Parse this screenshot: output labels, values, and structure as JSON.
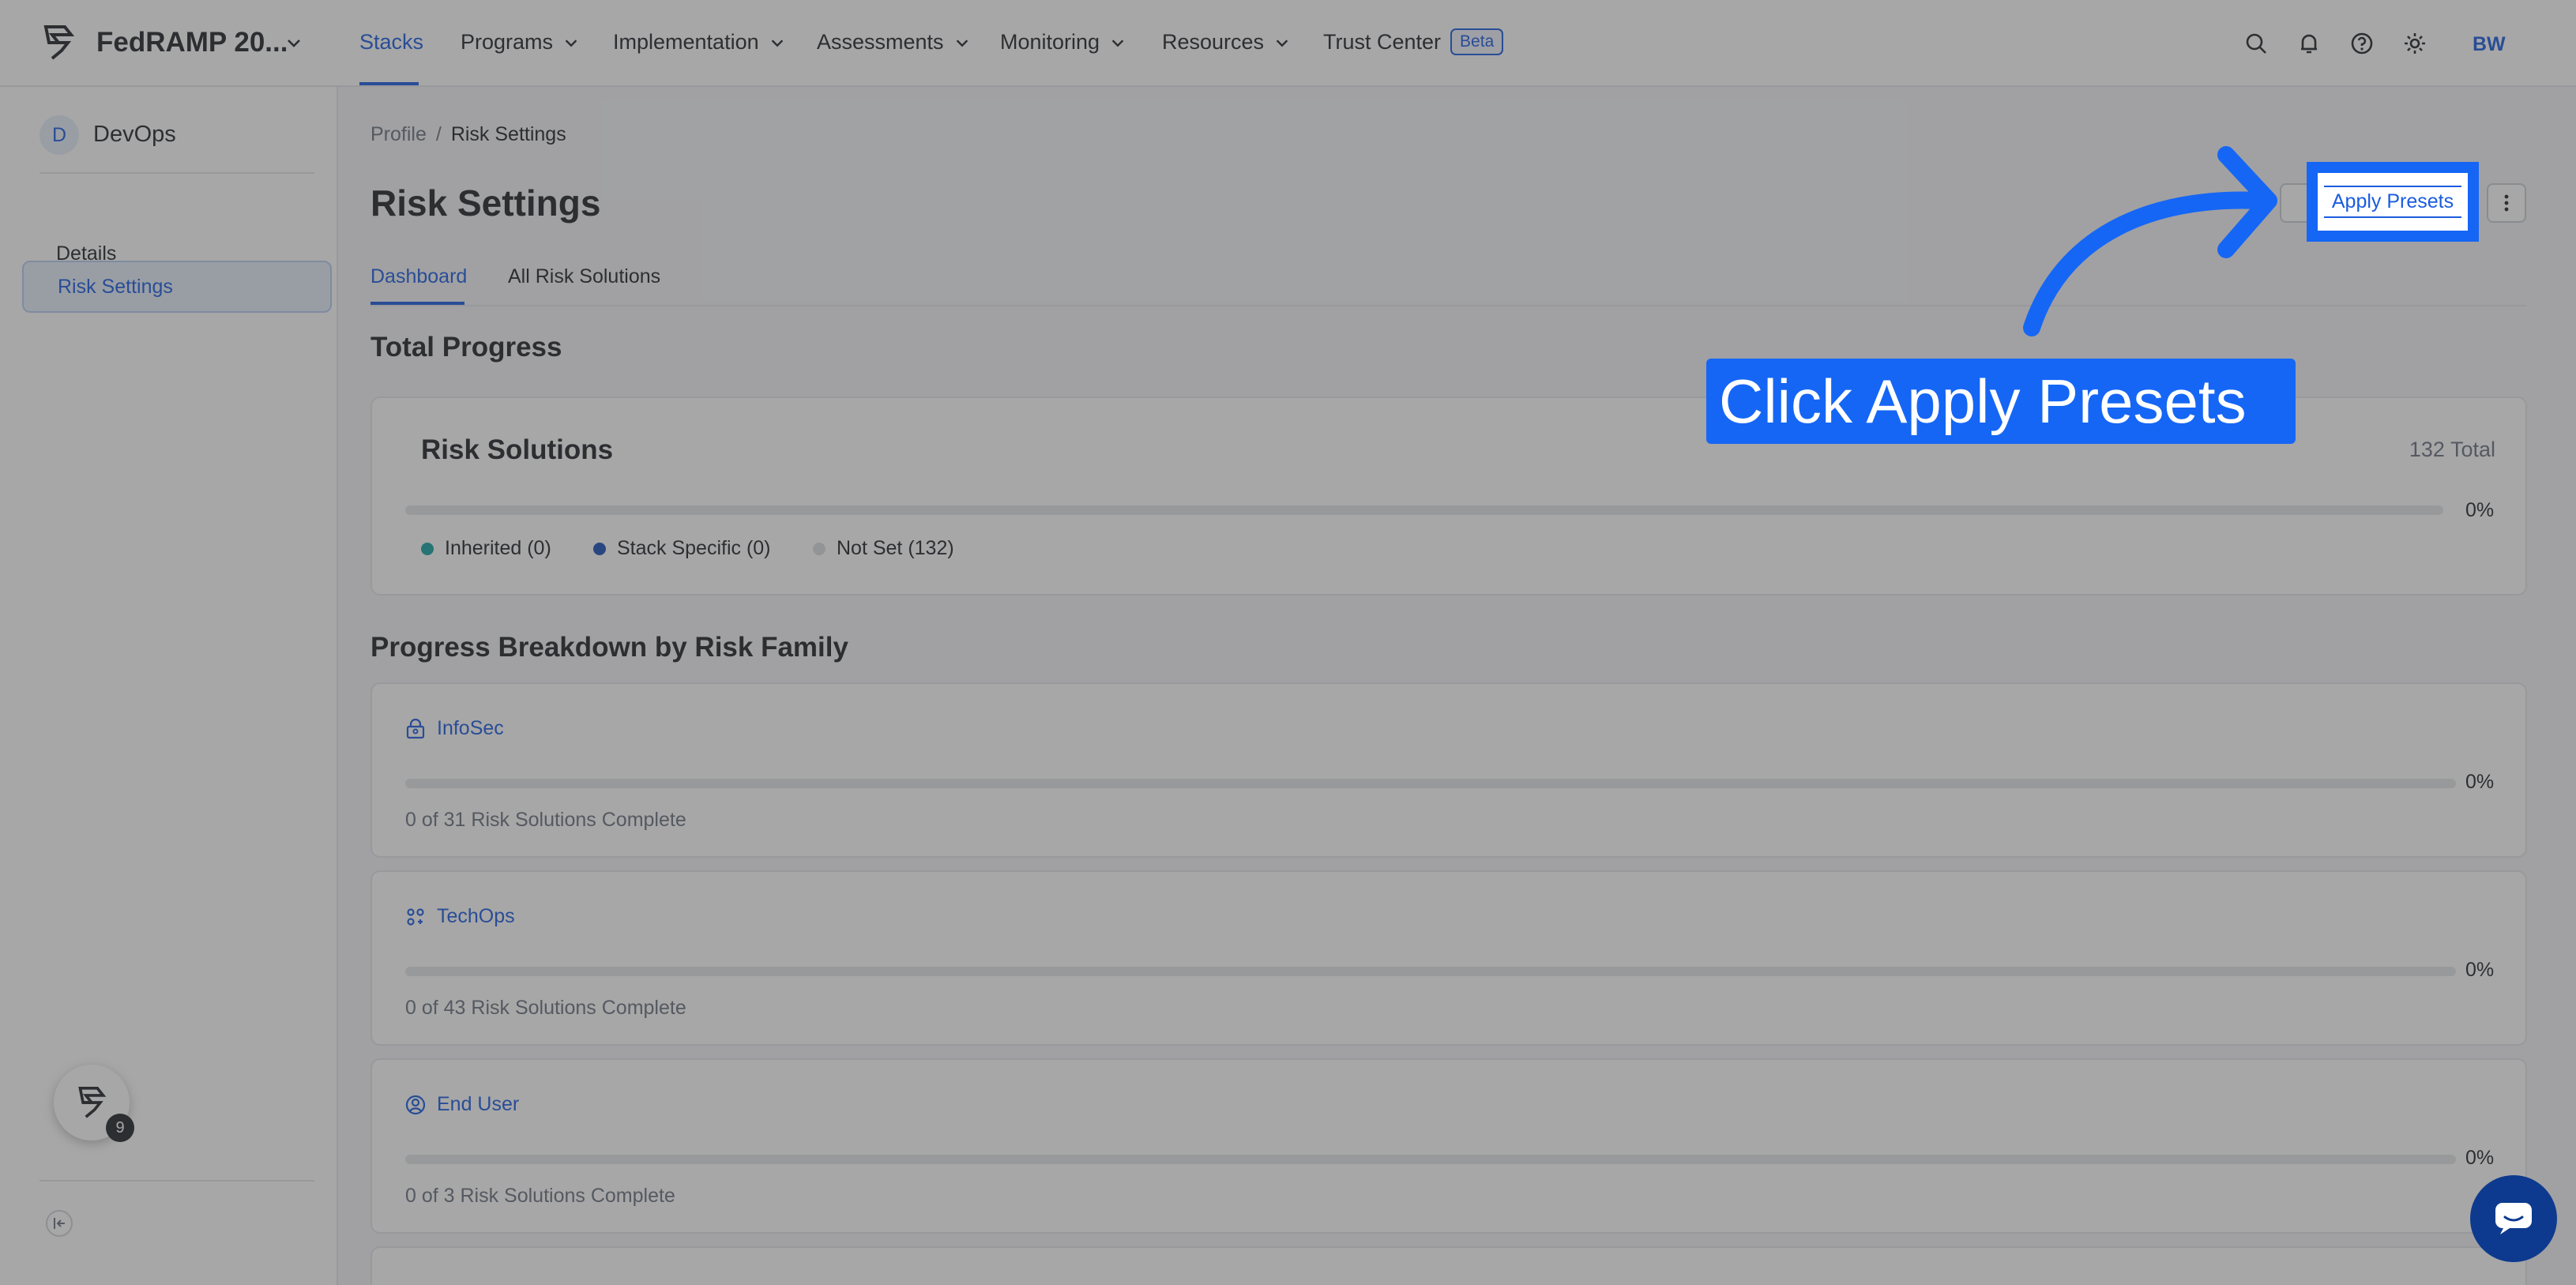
{
  "topnav": {
    "org_name": "FedRAMP 20...",
    "items": [
      {
        "label": "Stacks",
        "active": true,
        "has_menu": false
      },
      {
        "label": "Programs",
        "has_menu": true
      },
      {
        "label": "Implementation",
        "has_menu": true
      },
      {
        "label": "Assessments",
        "has_menu": true
      },
      {
        "label": "Monitoring",
        "has_menu": true
      },
      {
        "label": "Resources",
        "has_menu": true
      },
      {
        "label": "Trust Center",
        "has_menu": false
      }
    ],
    "beta_label": "Beta",
    "icons": [
      "search-icon",
      "bell-icon",
      "help-icon",
      "gear-icon"
    ],
    "user_initials": "BW"
  },
  "sidebar": {
    "avatar_letter": "D",
    "title": "DevOps",
    "items": [
      {
        "label": "Details",
        "active": false
      },
      {
        "label": "Risk Settings",
        "active": true
      }
    ],
    "launcher_badge": "9"
  },
  "breadcrumb": {
    "parent": "Profile",
    "separator": "/",
    "current": "Risk Settings"
  },
  "page": {
    "title": "Risk Settings",
    "tabs": [
      {
        "label": "Dashboard",
        "active": true
      },
      {
        "label": "All Risk Solutions",
        "active": false
      }
    ]
  },
  "total_progress": {
    "heading": "Total Progress",
    "card_title": "Risk Solutions",
    "total": "132 Total",
    "progress_fraction": 0,
    "percent_label": "0%",
    "legend": [
      {
        "label": "Inherited (0)",
        "color": "#14a3a3"
      },
      {
        "label": "Stack Specific (0)",
        "color": "#1a4fb8"
      },
      {
        "label": "Not Set (132)",
        "color": "#d9dce1"
      }
    ]
  },
  "breakdown": {
    "heading": "Progress Breakdown by Risk Family",
    "families": [
      {
        "name": "InfoSec",
        "icon": "lock-person-icon",
        "summary": "0 of 31 Risk Solutions Complete",
        "progress_fraction": 0,
        "percent_label": "0%"
      },
      {
        "name": "TechOps",
        "icon": "nodes-icon",
        "summary": "0 of 43 Risk Solutions Complete",
        "progress_fraction": 0,
        "percent_label": "0%"
      },
      {
        "name": "End User",
        "icon": "user-circle-icon",
        "summary": "0 of 3 Risk Solutions Complete",
        "progress_fraction": 0,
        "percent_label": "0%"
      }
    ]
  },
  "overlay": {
    "callout_text": "Click Apply Presets",
    "highlighted_button_label": "Apply Presets",
    "accent_color": "#1566f5"
  }
}
